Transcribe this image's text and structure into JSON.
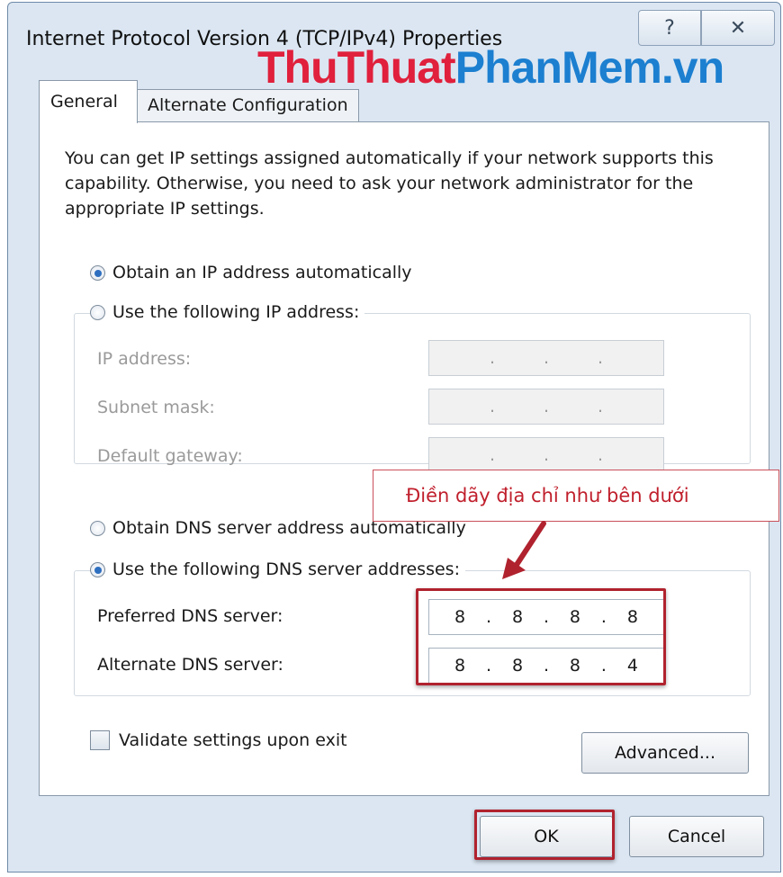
{
  "window": {
    "title": "Internet Protocol Version 4 (TCP/IPv4) Properties",
    "help_glyph": "?",
    "close_glyph": "✕"
  },
  "watermark": {
    "part1": "ThuThuat",
    "part2": "PhanMem.vn"
  },
  "tabs": [
    {
      "label": "General",
      "active": true
    },
    {
      "label": "Alternate Configuration",
      "active": false
    }
  ],
  "description": "You can get IP settings assigned automatically if your network supports this capability. Otherwise, you need to ask your network administrator for the appropriate IP settings.",
  "ip": {
    "auto_label": "Obtain an IP address automatically",
    "manual_label": "Use the following IP address:",
    "auto_selected": true,
    "fields": [
      {
        "label": "IP address:",
        "octets": [
          "",
          "",
          "",
          ""
        ]
      },
      {
        "label": "Subnet mask:",
        "octets": [
          "",
          "",
          "",
          ""
        ]
      },
      {
        "label": "Default gateway:",
        "octets": [
          "",
          "",
          "",
          ""
        ]
      }
    ]
  },
  "dns": {
    "auto_label": "Obtain DNS server address automatically",
    "manual_label": "Use the following DNS server addresses:",
    "manual_selected": true,
    "preferred": {
      "label": "Preferred DNS server:",
      "octets": [
        "8",
        "8",
        "8",
        "8"
      ]
    },
    "alternate": {
      "label": "Alternate DNS server:",
      "octets": [
        "8",
        "8",
        "8",
        "4"
      ]
    }
  },
  "annotation": {
    "text": "Điền dãy địa chỉ như bên dưới",
    "color": "#c01f2c"
  },
  "validate": {
    "label": "Validate settings upon exit",
    "checked": false
  },
  "buttons": {
    "advanced": "Advanced...",
    "ok": "OK",
    "cancel": "Cancel"
  },
  "dot": "."
}
